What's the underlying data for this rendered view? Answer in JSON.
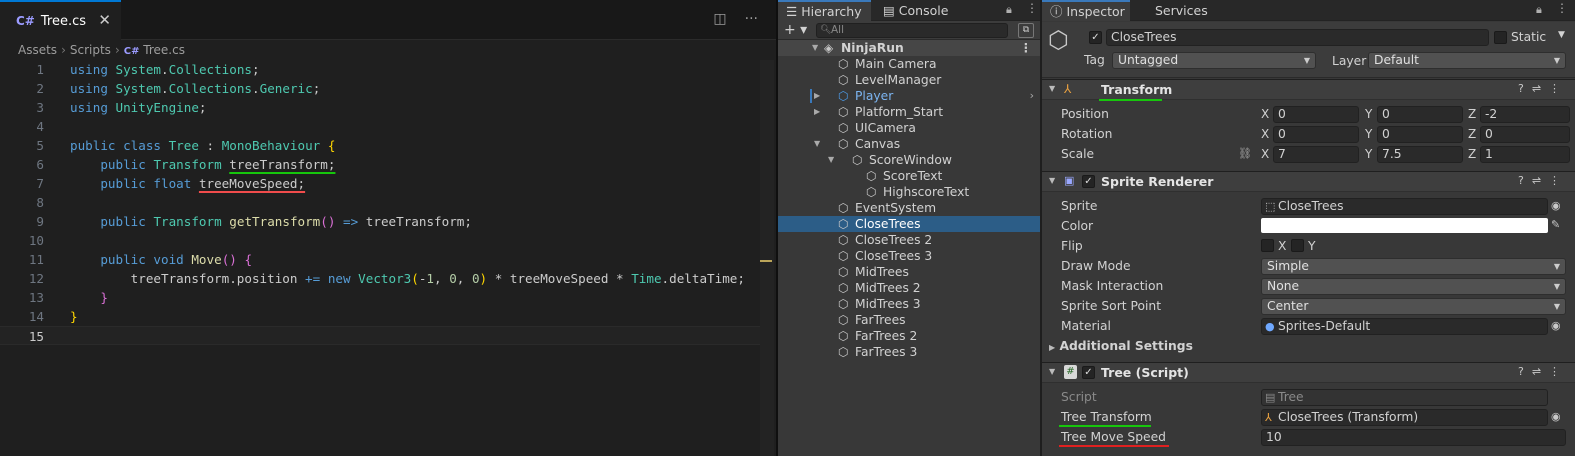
{
  "editor": {
    "tab": {
      "icon": "C#",
      "label": "Tree.cs"
    },
    "breadcrumb": [
      "Assets",
      "Scripts",
      "Tree.cs"
    ],
    "lines": [
      "1",
      "2",
      "3",
      "4",
      "5",
      "6",
      "7",
      "8",
      "9",
      "10",
      "11",
      "12",
      "13",
      "14",
      "15"
    ]
  },
  "hierarchy": {
    "tabs": [
      "Hierarchy",
      "Console"
    ],
    "search_placeholder": "All",
    "scene": "NinjaRun",
    "items": [
      "Main Camera",
      "LevelManager",
      "Player",
      "Platform_Start",
      "UICamera",
      "Canvas",
      "ScoreWindow",
      "ScoreText",
      "HighscoreText",
      "EventSystem",
      "CloseTrees",
      "CloseTrees 2",
      "CloseTrees 3",
      "MidTrees",
      "MidTrees 2",
      "MidTrees 3",
      "FarTrees",
      "FarTrees 2",
      "FarTrees 3"
    ],
    "selected": "CloseTrees"
  },
  "inspector": {
    "tabs": [
      "Inspector",
      "Services"
    ],
    "object_name": "CloseTrees",
    "static_label": "Static",
    "tag_label": "Tag",
    "tag_value": "Untagged",
    "layer_label": "Layer",
    "layer_value": "Default",
    "transform": {
      "title": "Transform",
      "position_label": "Position",
      "rotation_label": "Rotation",
      "scale_label": "Scale",
      "axes": [
        "X",
        "Y",
        "Z"
      ],
      "position": [
        "0",
        "0",
        "-2"
      ],
      "rotation": [
        "0",
        "0",
        "0"
      ],
      "scale": [
        "7",
        "7.5",
        "1"
      ]
    },
    "sprite_renderer": {
      "title": "Sprite Renderer",
      "sprite_label": "Sprite",
      "sprite_value": "CloseTrees",
      "color_label": "Color",
      "color_value": "#ffffff",
      "flip_label": "Flip",
      "flip_x": "X",
      "flip_y": "Y",
      "draw_mode_label": "Draw Mode",
      "draw_mode_value": "Simple",
      "mask_label": "Mask Interaction",
      "mask_value": "None",
      "sort_label": "Sprite Sort Point",
      "sort_value": "Center",
      "material_label": "Material",
      "material_value": "Sprites-Default",
      "additional": "Additional Settings"
    },
    "tree_script": {
      "title": "Tree (Script)",
      "script_label": "Script",
      "script_value": "Tree",
      "transform_label": "Tree Transform",
      "transform_value": "CloseTrees (Transform)",
      "speed_label": "Tree Move Speed",
      "speed_value": "10"
    }
  }
}
